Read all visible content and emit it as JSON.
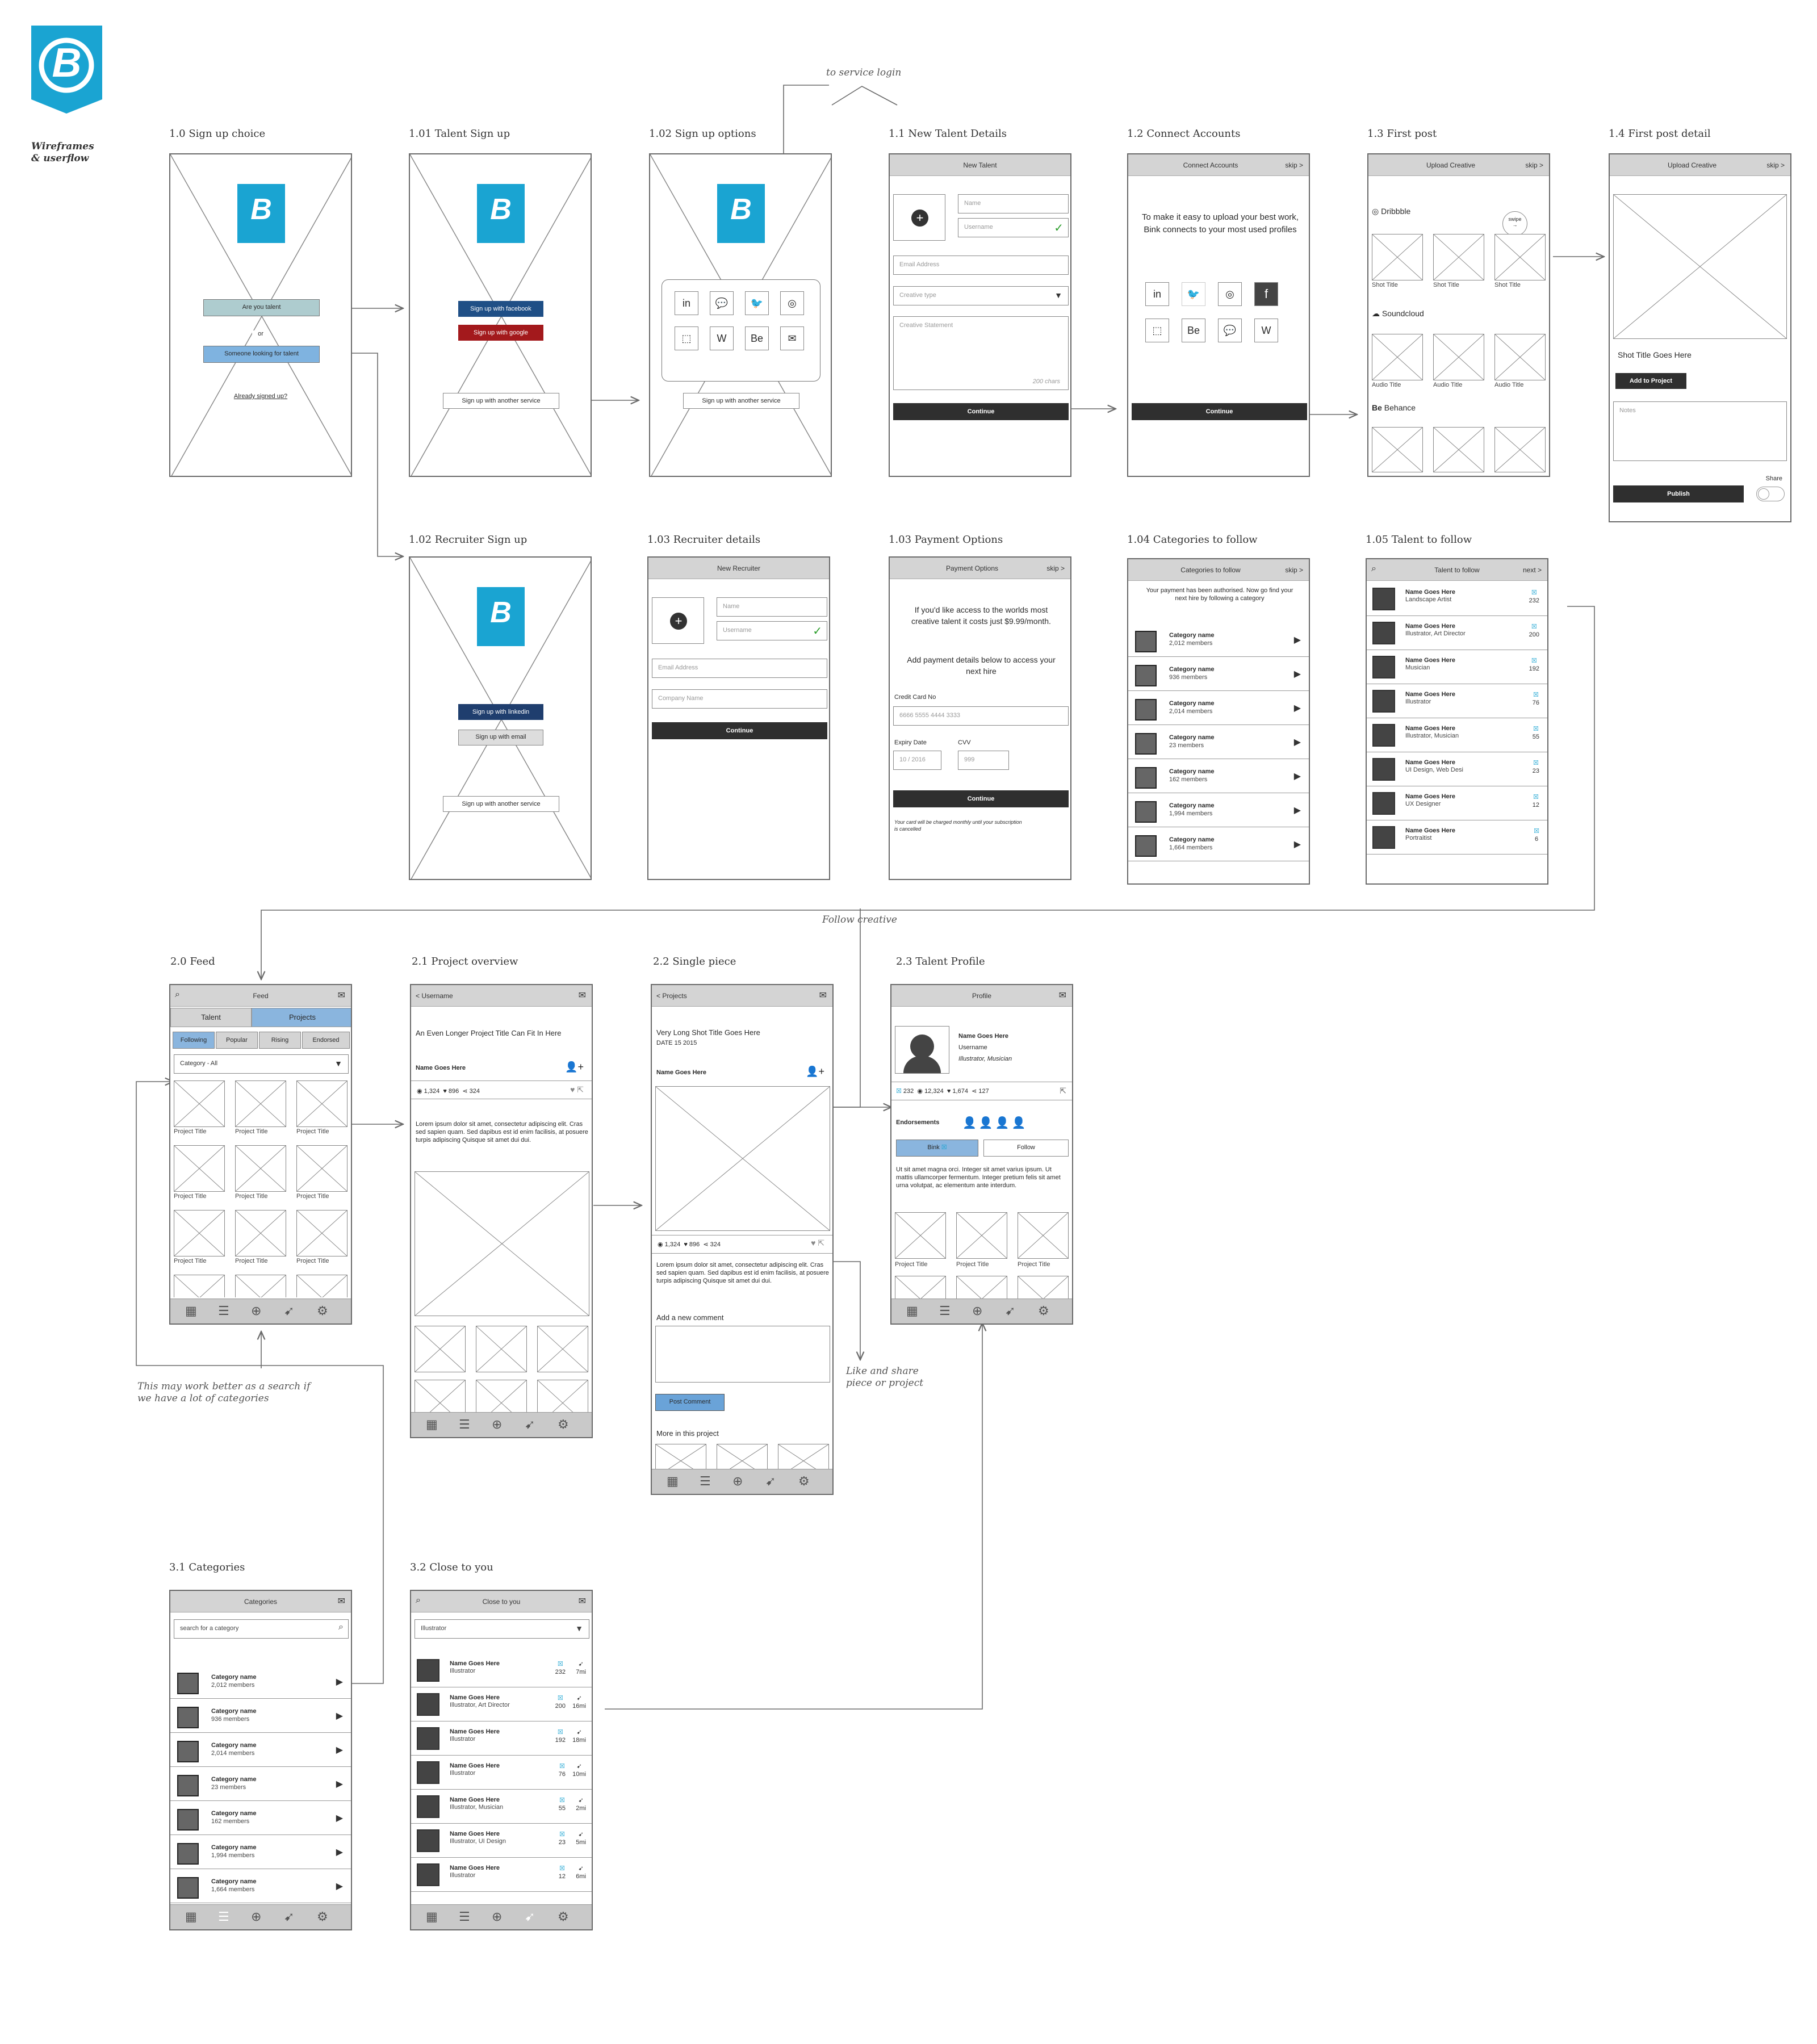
{
  "brand": {
    "logo_letter": "B",
    "tagline": [
      "Wireframes",
      "& userflow"
    ],
    "accent": "#1aa4d2"
  },
  "notes": {
    "service_login": "to service login",
    "follow_creative": "Follow creative",
    "categories_note": [
      "This may work better as a search if",
      "we have a lot of categories"
    ],
    "like_share": [
      "Like and share",
      "piece or project"
    ]
  },
  "titles": {
    "s10": "1.0 Sign up choice",
    "s101": "1.01 Talent Sign up",
    "s102": "1.02 Sign up options",
    "s11": "1.1 New Talent Details",
    "s12": "1.2 Connect Accounts",
    "s13": "1.3 First post",
    "s14": "1.4 First post detail",
    "s102r": "1.02 Recruiter Sign up",
    "s103r": "1.03 Recruiter details",
    "s103p": "1.03 Payment Options",
    "s104": "1.04 Categories to follow",
    "s105": "1.05 Talent to follow",
    "s20": "2.0 Feed",
    "s21": "2.1 Project overview",
    "s22": "2.2 Single piece",
    "s23": "2.3 Talent Profile",
    "s31": "3.1 Categories",
    "s32": "3.2 Close to you"
  },
  "s10": {
    "talent": "Are you talent",
    "or": "or",
    "recruiter": "Someone looking for talent",
    "signed": "Already signed up?"
  },
  "s101": {
    "facebook": "Sign up with facebook",
    "google": "Sign up with google",
    "another": "Sign up with another service"
  },
  "s102": {
    "another": "Sign up with another service",
    "icons": [
      "in",
      "💬",
      "🐦",
      "◎",
      "⬚",
      "W",
      "Be",
      "✉"
    ]
  },
  "s11": {
    "header": "New Talent",
    "name": "Name",
    "username": "Username",
    "email": "Email Address",
    "type": "Creative type",
    "statement": "Creative Statement",
    "chars": "200 chars",
    "continue": "Continue"
  },
  "s12": {
    "header": "Connect Accounts",
    "skip": "skip >",
    "text": "To make it easy to upload your best work, Bink connects to your most used profiles",
    "continue": "Continue",
    "icons": [
      "in",
      "🐦",
      "◎",
      "f",
      "⬚",
      "Be",
      "💬",
      "W"
    ]
  },
  "s13": {
    "header": "Upload Creative",
    "skip": "skip >",
    "swipe": "swipe",
    "dribbble": "Dribbble",
    "soundcloud": "Soundcloud",
    "behance": "Behance",
    "shot": "Shot Title",
    "audio": "Audio Title"
  },
  "s14": {
    "header": "Upload Creative",
    "skip": "skip >",
    "title": "Shot Title Goes Here",
    "add": "Add to Project",
    "notes": "Notes",
    "share": "Share",
    "publish": "Publish"
  },
  "s102r": {
    "linkedin": "Sign up with linkedin",
    "email": "Sign up with email",
    "another": "Sign up with another service"
  },
  "s103r": {
    "header": "New Recruiter",
    "name": "Name",
    "username": "Username",
    "email": "Email Address",
    "company": "Company Name",
    "continue": "Continue"
  },
  "s103p": {
    "header": "Payment Options",
    "skip": "skip >",
    "text1": "If you'd like access to the worlds most creative talent it costs just $9.99/month.",
    "text2": "Add payment details below to access your next hire",
    "cc_label": "Credit Card No",
    "cc": "6666 5555 4444 3333",
    "exp_label": "Expiry Date",
    "cvv_label": "CVV",
    "exp": "10 / 2016",
    "cvv": "999",
    "continue": "Continue",
    "fine": "Your card will be charged monthly until your subscription is cancelled"
  },
  "s104": {
    "header": "Categories to follow",
    "skip": "skip >",
    "intro": "Your payment has been authorised. Now go find your next hire by following a category",
    "items": [
      {
        "name": "Category name",
        "members": "2,012 members"
      },
      {
        "name": "Category name",
        "members": "936 members"
      },
      {
        "name": "Category name",
        "members": "2,014 members"
      },
      {
        "name": "Category name",
        "members": "23 members"
      },
      {
        "name": "Category name",
        "members": "162 members"
      },
      {
        "name": "Category name",
        "members": "1,994 members"
      },
      {
        "name": "Category name",
        "members": "1,664 members"
      }
    ]
  },
  "s105": {
    "header": "Talent to follow",
    "next": "next >",
    "items": [
      {
        "name": "Name Goes Here",
        "role": "Landscape Artist",
        "count": "232"
      },
      {
        "name": "Name Goes Here",
        "role": "Illustrator, Art Director",
        "count": "200"
      },
      {
        "name": "Name Goes Here",
        "role": "Musician",
        "count": "192"
      },
      {
        "name": "Name Goes Here",
        "role": "Illustrator",
        "count": "76"
      },
      {
        "name": "Name Goes Here",
        "role": "Illustrator, Musician",
        "count": "55"
      },
      {
        "name": "Name Goes Here",
        "role": "UI Design, Web Desi",
        "count": "23"
      },
      {
        "name": "Name Goes Here",
        "role": "UX Designer",
        "count": "12"
      },
      {
        "name": "Name Goes Here",
        "role": "Portraitist",
        "count": "6"
      }
    ]
  },
  "s20": {
    "header": "Feed",
    "tab1": "Talent",
    "tab2": "Projects",
    "filters": [
      "Following",
      "Popular",
      "Rising",
      "Endorsed"
    ],
    "category": "Category - All",
    "project": "Project Title"
  },
  "s21": {
    "back": "< Username",
    "title": "An Even Longer Project Title Can Fit In Here",
    "name": "Name Goes Here",
    "views": "1,324",
    "likes": "896",
    "shares": "324",
    "body": "Lorem ipsum dolor sit amet, consectetur adipiscing elit. Cras sed sapien quam. Sed dapibus est id enim facilisis, at posuere turpis adipiscing Quisque sit amet dui dui."
  },
  "s22": {
    "back": "< Projects",
    "title": "Very Long Shot Title Goes Here",
    "date": "DATE 15 2015",
    "name": "Name Goes Here",
    "views": "1,324",
    "likes": "896",
    "shares": "324",
    "body": "Lorem ipsum dolor sit amet, consectetur adipiscing elit. Cras sed sapien quam. Sed dapibus est id enim facilisis, at posuere turpis adipiscing Quisque sit amet dui dui.",
    "add_comment": "Add a new comment",
    "post": "Post Comment",
    "more": "More in this project"
  },
  "s23": {
    "header": "Profile",
    "name": "Name Goes Here",
    "username": "Username",
    "role": "Illustrator, Musician",
    "followers": "232",
    "views": "12,324",
    "likes": "1,674",
    "shares": "127",
    "endorse": "Endorsements",
    "bink": "Bink",
    "follow": "Follow",
    "body": "Ut sit amet magna orci. Integer sit amet varius ipsum. Ut mattis ullamcorper fermentum. Integer pretium felis sit amet urna volutpat, ac elementum ante interdum.",
    "project": "Project Title"
  },
  "s31": {
    "header": "Categories",
    "search": "search for a category",
    "items": [
      {
        "name": "Category name",
        "members": "2,012 members"
      },
      {
        "name": "Category name",
        "members": "936 members"
      },
      {
        "name": "Category name",
        "members": "2,014 members"
      },
      {
        "name": "Category name",
        "members": "23 members"
      },
      {
        "name": "Category name",
        "members": "162 members"
      },
      {
        "name": "Category name",
        "members": "1,994 members"
      },
      {
        "name": "Category name",
        "members": "1,664 members"
      }
    ]
  },
  "s32": {
    "header": "Close to you",
    "filter": "Illustrator",
    "items": [
      {
        "name": "Name Goes Here",
        "role": "Illustrator",
        "count": "232",
        "dist": "7mi"
      },
      {
        "name": "Name Goes Here",
        "role": "Illustrator, Art Director",
        "count": "200",
        "dist": "16mi"
      },
      {
        "name": "Name Goes Here",
        "role": "Illustrator",
        "count": "192",
        "dist": "18mi"
      },
      {
        "name": "Name Goes Here",
        "role": "Illustrator",
        "count": "76",
        "dist": "10mi"
      },
      {
        "name": "Name Goes Here",
        "role": "Illustrator, Musician",
        "count": "55",
        "dist": "2mi"
      },
      {
        "name": "Name Goes Here",
        "role": "Illustrator, UI Design",
        "count": "23",
        "dist": "5mi"
      },
      {
        "name": "Name Goes Here",
        "role": "Illustrator",
        "count": "12",
        "dist": "6mi"
      }
    ]
  }
}
